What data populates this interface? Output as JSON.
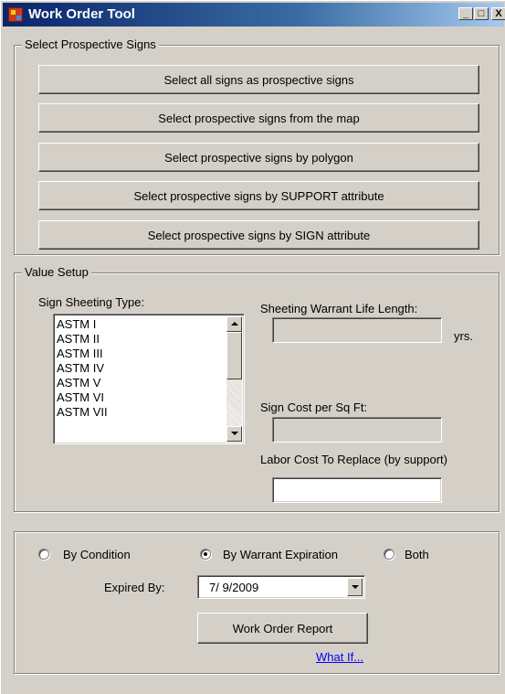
{
  "window": {
    "title": "Work Order Tool",
    "controls": {
      "minimize": "_",
      "maximize": "□",
      "close": "X"
    }
  },
  "prospective_signs": {
    "legend": "Select Prospective Signs",
    "buttons": [
      "Select all signs as prospective signs",
      "Select prospective signs from the map",
      "Select prospective signs by polygon",
      "Select prospective signs by SUPPORT attribute",
      "Select prospective signs by SIGN attribute"
    ]
  },
  "value_setup": {
    "legend": "Value Setup",
    "sheeting_type_label": "Sign Sheeting Type:",
    "sheeting_types": [
      "ASTM I",
      "ASTM II",
      "ASTM III",
      "ASTM IV",
      "ASTM V",
      "ASTM VI",
      "ASTM VII"
    ],
    "warrant_life_label": "Sheeting Warrant Life Length:",
    "warrant_life_value": "",
    "warrant_life_unit": "yrs.",
    "sign_cost_label": "Sign Cost per Sq Ft:",
    "sign_cost_value": "",
    "labor_cost_label": "Labor Cost To Replace (by support)",
    "labor_cost_value": ""
  },
  "report": {
    "radio_by_condition": "By Condition",
    "radio_by_warrant": "By Warrant Expiration",
    "radio_both": "Both",
    "selected_radio": "By Warrant Expiration",
    "expired_by_label": "Expired By:",
    "expired_by_value": "7/  9/2009",
    "report_button": "Work Order Report",
    "what_if_link": "What If..."
  },
  "colors": {
    "face": "#d4d0c8",
    "titlebar_start": "#0a246a",
    "titlebar_end": "#a6caf0",
    "link": "#0000ff"
  }
}
